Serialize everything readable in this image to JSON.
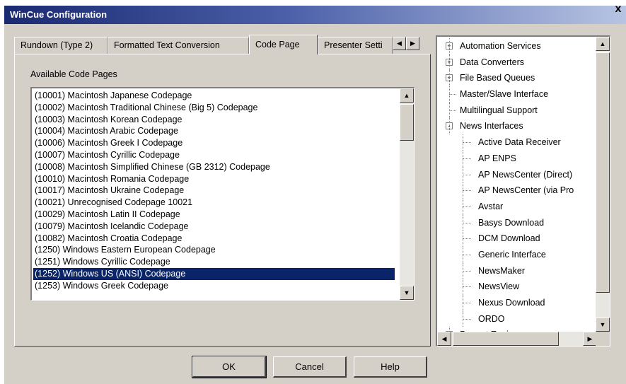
{
  "window": {
    "title": "WinCue Configuration",
    "close_glyph": "x"
  },
  "tabs": [
    {
      "label": "Rundown (Type 2)"
    },
    {
      "label": "Formatted Text Conversion"
    },
    {
      "label": "Code Page"
    },
    {
      "label": "Presenter Setti"
    }
  ],
  "active_tab": "Code Page",
  "code_page": {
    "label": "Available Code Pages",
    "items": [
      "(10001) Macintosh Japanese Codepage",
      "(10002) Macintosh Traditional Chinese (Big 5) Codepage",
      "(10003) Macintosh Korean Codepage",
      "(10004) Macintosh Arabic Codepage",
      "(10006) Macintosh Greek I Codepage",
      "(10007) Macintosh Cyrillic Codepage",
      "(10008) Macintosh Simplified Chinese (GB 2312) Codepage",
      "(10010) Macintosh Romania Codepage",
      "(10017) Macintosh Ukraine Codepage",
      "(10021) Unrecognised Codepage 10021",
      "(10029) Macintosh Latin II Codepage",
      "(10079) Macintosh Icelandic Codepage",
      "(10082) Macintosh Croatia Codepage",
      "(1250) Windows Eastern European Codepage",
      "(1251) Windows Cyrillic Codepage",
      "(1252) Windows US (ANSI) Codepage",
      "(1253) Windows Greek Codepage"
    ],
    "selected": "(1252) Windows US (ANSI) Codepage"
  },
  "tree": {
    "items": [
      {
        "label": "Automation Services",
        "level": 0,
        "expander": "+"
      },
      {
        "label": "Data Converters",
        "level": 0,
        "expander": "+"
      },
      {
        "label": "File Based Queues",
        "level": 0,
        "expander": "+"
      },
      {
        "label": "Master/Slave Interface",
        "level": 0,
        "expander": ""
      },
      {
        "label": "Multilingual Support",
        "level": 0,
        "expander": ""
      },
      {
        "label": "News Interfaces",
        "level": 0,
        "expander": "-"
      },
      {
        "label": "Active Data Receiver",
        "level": 1,
        "expander": ""
      },
      {
        "label": "AP ENPS",
        "level": 1,
        "expander": ""
      },
      {
        "label": "AP NewsCenter (Direct)",
        "level": 1,
        "expander": ""
      },
      {
        "label": "AP NewsCenter (via Pro",
        "level": 1,
        "expander": ""
      },
      {
        "label": "Avstar",
        "level": 1,
        "expander": ""
      },
      {
        "label": "Basys Download",
        "level": 1,
        "expander": ""
      },
      {
        "label": "DCM Download",
        "level": 1,
        "expander": ""
      },
      {
        "label": "Generic Interface",
        "level": 1,
        "expander": ""
      },
      {
        "label": "NewsMaker",
        "level": 1,
        "expander": ""
      },
      {
        "label": "NewsView",
        "level": 1,
        "expander": ""
      },
      {
        "label": "Nexus Download",
        "level": 1,
        "expander": ""
      },
      {
        "label": "ORDO",
        "level": 1,
        "expander": ""
      },
      {
        "label": "Prompt Engine",
        "level": 0,
        "expander": "+"
      }
    ]
  },
  "buttons": {
    "ok": "OK",
    "cancel": "Cancel",
    "help": "Help"
  },
  "colors": {
    "selection": "#0a246a",
    "face": "#d4d0c8",
    "title_start": "#1a2a72"
  }
}
